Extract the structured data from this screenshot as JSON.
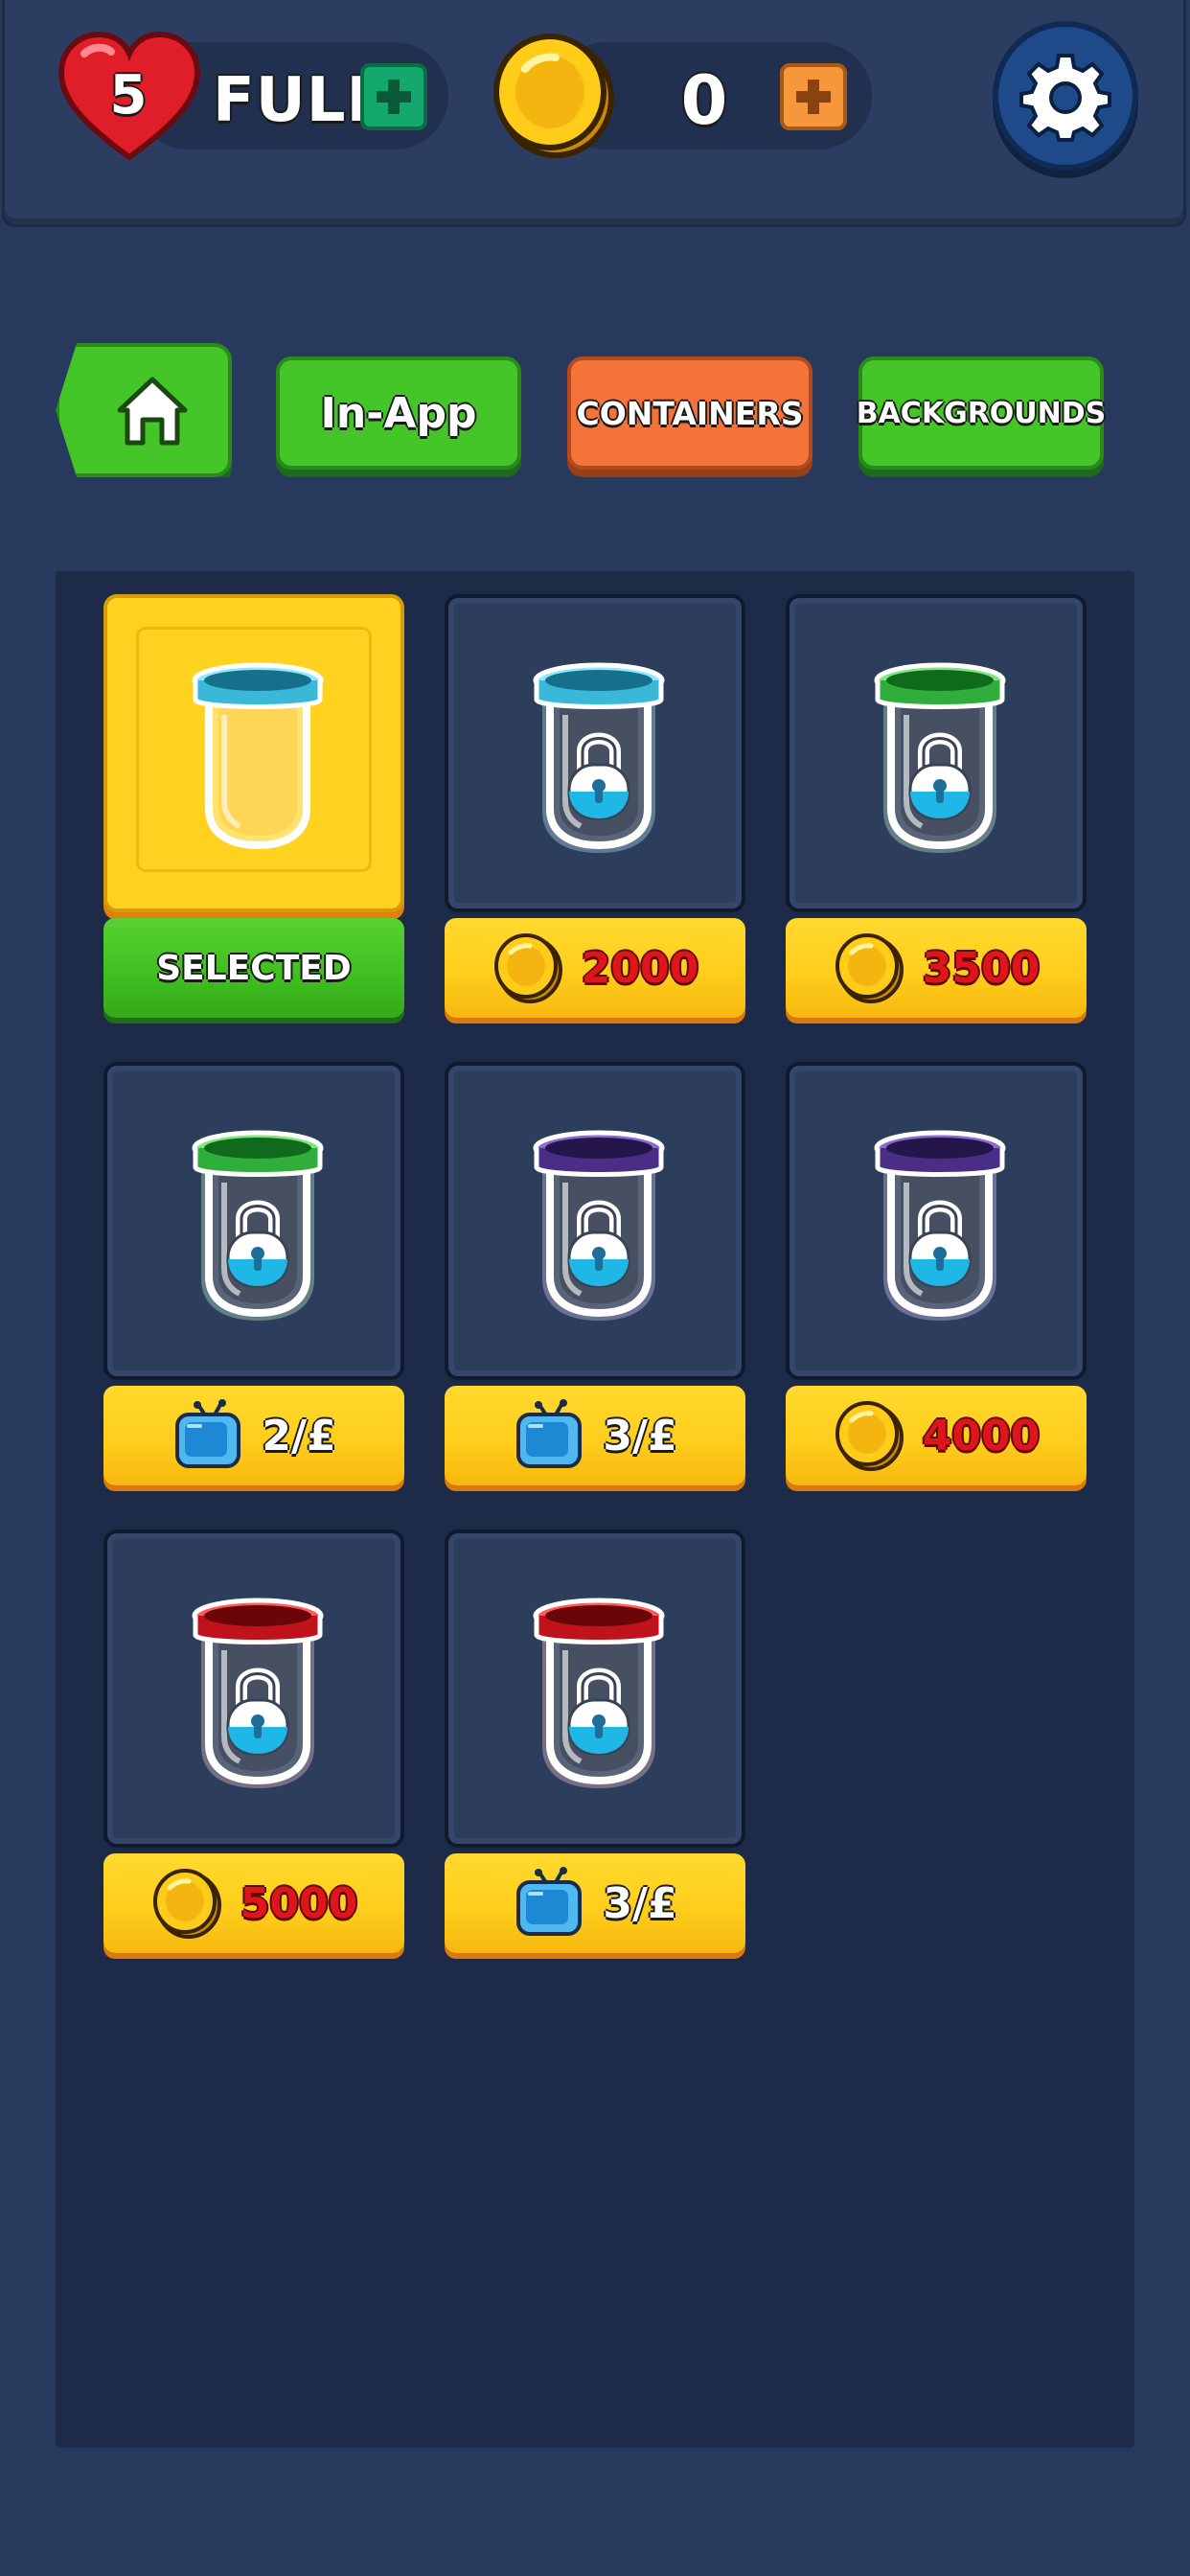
{
  "hud": {
    "lives": "5",
    "lives_status": "FULL",
    "coins": "0"
  },
  "tabs": [
    {
      "id": "home",
      "label": ""
    },
    {
      "id": "in-app",
      "label": "In-App"
    },
    {
      "id": "containers",
      "label": "CONTAINERS"
    },
    {
      "id": "backgrounds",
      "label": "BACKGROUNDS"
    }
  ],
  "active_tab": "containers",
  "colors": {
    "background": "#273a5e",
    "tab_green": "#45c628",
    "tab_active_orange": "#f4733a",
    "price_yellow": "#ffce1c",
    "price_red_text": "#e0151b",
    "selected_green": "#3fbe1f"
  },
  "items": [
    {
      "color": "cyan",
      "state": "selected",
      "label": "SELECTED",
      "currency": "none"
    },
    {
      "color": "cyan",
      "state": "locked",
      "label": "2000",
      "currency": "coin"
    },
    {
      "color": "green",
      "state": "locked",
      "label": "3500",
      "currency": "coin"
    },
    {
      "color": "green",
      "state": "locked",
      "label": "2/£",
      "currency": "tv-ad"
    },
    {
      "color": "purple",
      "state": "locked",
      "label": "3/£",
      "currency": "tv-ad"
    },
    {
      "color": "purple",
      "state": "locked",
      "label": "4000",
      "currency": "coin"
    },
    {
      "color": "red",
      "state": "locked",
      "label": "5000",
      "currency": "coin"
    },
    {
      "color": "red",
      "state": "locked",
      "label": "3/£",
      "currency": "tv-ad"
    }
  ]
}
